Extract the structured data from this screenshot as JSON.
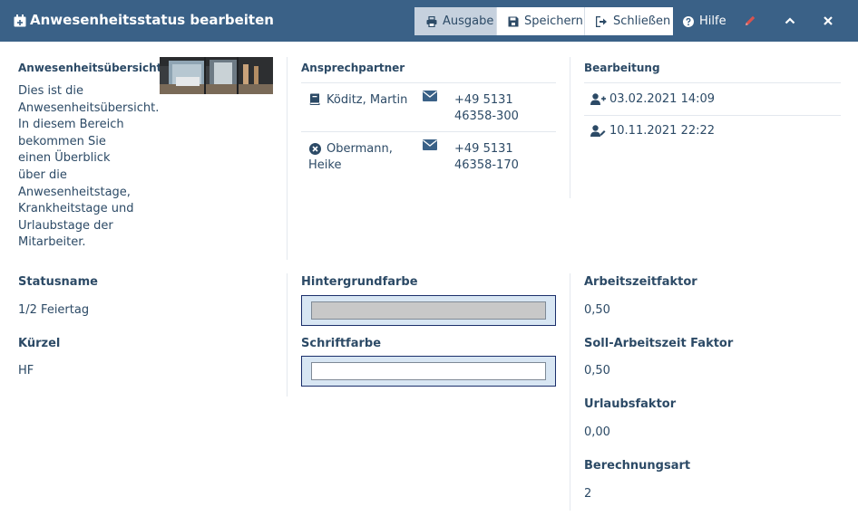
{
  "window": {
    "title": "Anwesenheitsstatus bearbeiten",
    "title_icon": "calendar-add-icon"
  },
  "toolbar": {
    "output_label": "Ausgabe",
    "save_label": "Speichern",
    "close_label": "Schließen",
    "help_label": "Hilfe",
    "icons": [
      "printer-icon",
      "floppy-disk-icon",
      "exit-icon",
      "question-circle-icon",
      "pencil-icon",
      "chevron-up-icon",
      "close-icon"
    ]
  },
  "overview": {
    "heading": "Anwesenheitsübersicht",
    "text_lines": [
      "Dies ist die",
      "Anwesenheitsübersicht.",
      "In diesem Bereich",
      "bekommen Sie",
      "einen Überblick",
      "über die",
      "Anwesenheitstage,",
      "Krankheitstage und",
      "Urlaubstage der",
      "Mitarbeiter."
    ]
  },
  "contacts": {
    "heading": "Ansprechpartner",
    "items": [
      {
        "name": "Köditz, Martin",
        "phone_line1": "+49 5131",
        "phone_line2": "46358-300",
        "status_icon": "book-icon",
        "contact_icon": "envelope-icon"
      },
      {
        "name_line1": "Obermann,",
        "name_line2": "Heike",
        "phone_line1": "+49 5131",
        "phone_line2": "46358-170",
        "status_icon": "x-circle-icon",
        "contact_icon": "envelope-icon"
      }
    ]
  },
  "editing": {
    "heading": "Bearbeitung",
    "created": "03.02.2021 14:09",
    "modified": "10.11.2021 22:22"
  },
  "fields": {
    "status_name_label": "Statusname",
    "status_name_value": "1/2 Feiertag",
    "short_label": "Kürzel",
    "short_value": "HF",
    "bg_color_label": "Hintergrundfarbe",
    "bg_color_value": "#c8c8c8",
    "font_color_label": "Schriftfarbe",
    "font_color_value": "#ffffff",
    "work_factor_label": "Arbeitszeitfaktor",
    "work_factor_value": "0,50",
    "target_factor_label": "Soll-Arbeitszeit Faktor",
    "target_factor_value": "0,50",
    "vacation_factor_label": "Urlaubsfaktor",
    "vacation_factor_value": "0,00",
    "calc_type_label": "Berechnungsart",
    "calc_type_value": "2"
  },
  "colors": {
    "titlebar": "#3a6187",
    "text": "#2c4a66",
    "accent_red": "#d9534f"
  }
}
